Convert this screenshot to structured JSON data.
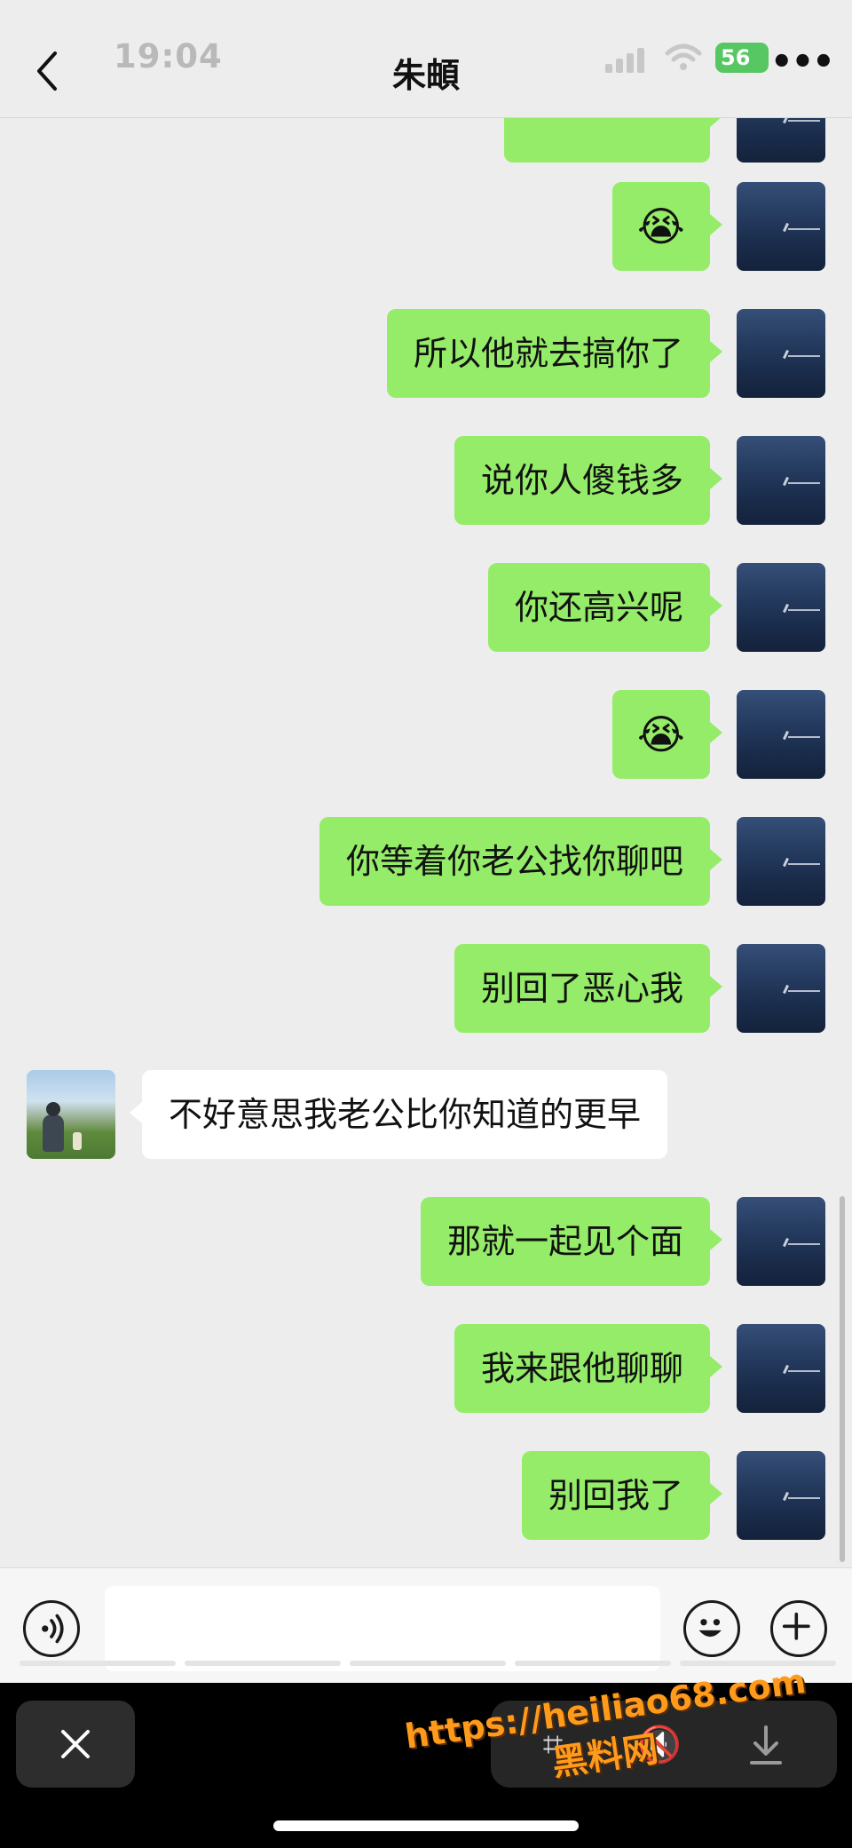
{
  "status_bar": {
    "time": "19:04",
    "battery": "56"
  },
  "header": {
    "title": "朱頔"
  },
  "messages": [
    {
      "side": "out",
      "text": ""
    },
    {
      "side": "out",
      "text": "😭"
    },
    {
      "side": "out",
      "text": "所以他就去搞你了"
    },
    {
      "side": "out",
      "text": "说你人傻钱多"
    },
    {
      "side": "out",
      "text": "你还高兴呢"
    },
    {
      "side": "out",
      "text": "😭"
    },
    {
      "side": "out",
      "text": "你等着你老公找你聊吧"
    },
    {
      "side": "out",
      "text": "别回了恶心我"
    },
    {
      "side": "in",
      "text": "不好意思我老公比你知道的更早"
    },
    {
      "side": "out",
      "text": "那就一起见个面"
    },
    {
      "side": "out",
      "text": "我来跟他聊聊"
    },
    {
      "side": "out",
      "text": "别回我了"
    }
  ],
  "input": {
    "placeholder": ""
  },
  "watermark": {
    "url": "https://heiliao68.com",
    "name": "黑料网"
  },
  "colors": {
    "outgoing_bubble": "#95ec69",
    "incoming_bubble": "#ffffff",
    "chat_background": "#ededed"
  },
  "icons": [
    "back-icon",
    "signal-icon",
    "wifi-icon",
    "more-icon",
    "voice-icon",
    "emoji-icon",
    "plus-icon",
    "close-icon",
    "scan-icon",
    "mute-icon",
    "download-icon"
  ]
}
